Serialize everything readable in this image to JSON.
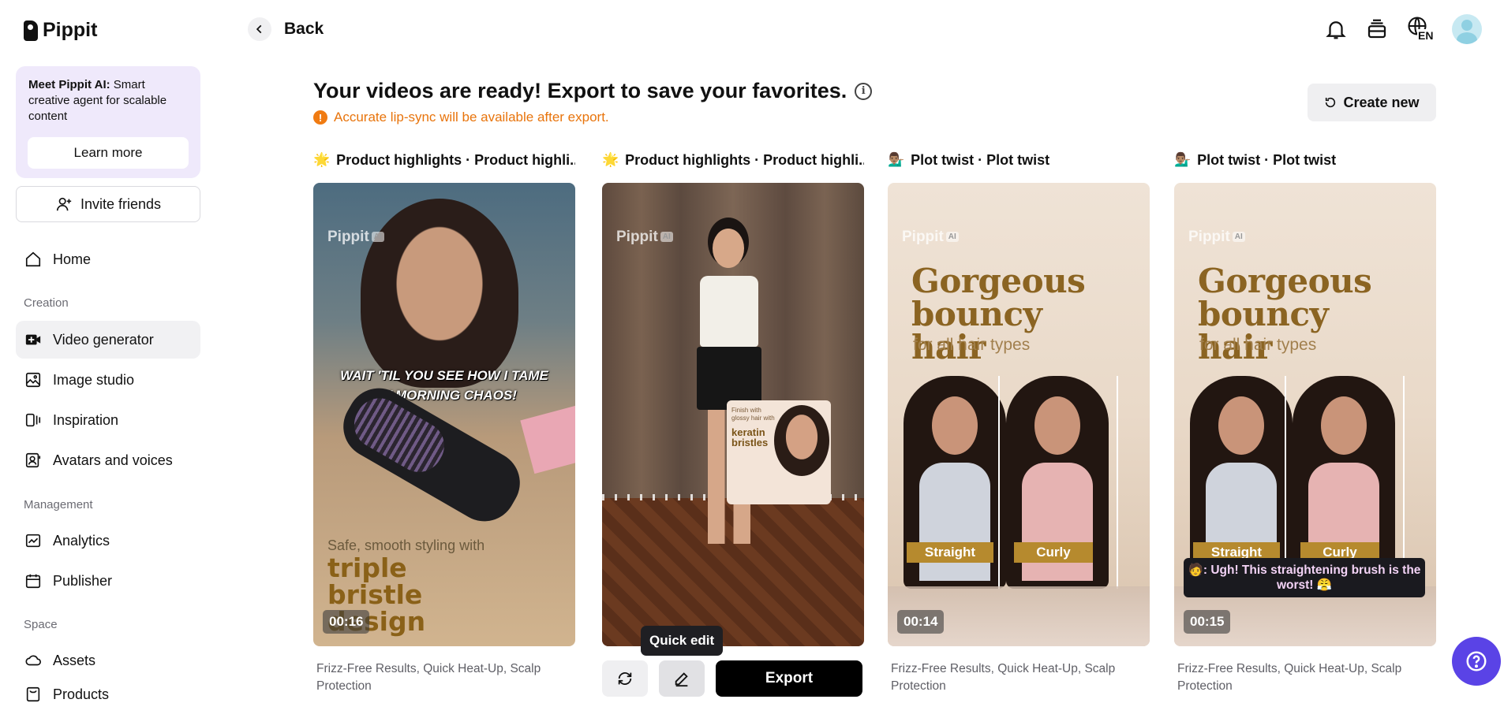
{
  "app": {
    "name": "Pippit"
  },
  "sidebar": {
    "promo_title": "Meet Pippit AI:",
    "promo_body": " Smart creative agent for scalable content",
    "learn_more": "Learn more",
    "invite": "Invite friends",
    "home": "Home",
    "sections": {
      "creation": "Creation",
      "management": "Management",
      "space": "Space"
    },
    "items": {
      "video_generator": "Video generator",
      "image_studio": "Image studio",
      "inspiration": "Inspiration",
      "avatars_voices": "Avatars and voices",
      "analytics": "Analytics",
      "publisher": "Publisher",
      "assets": "Assets",
      "products": "Products"
    },
    "active": "video_generator"
  },
  "topbar": {
    "back": "Back",
    "language": "EN"
  },
  "main": {
    "headline": "Your videos are ready! Export to save your favorites.",
    "info_glyph": "i",
    "warning_glyph": "!",
    "warning": "Accurate lip-sync will be available after export.",
    "create_new": "Create new"
  },
  "cards": [
    {
      "emoji": "🌟",
      "title": "Product highlights · Product highli...",
      "watermark": "Pippit",
      "watermark_badge": "AI",
      "caption": "WAIT 'TIL YOU SEE HOW I TAME MY MORNING CHAOS!",
      "overlay_small": "Safe, smooth styling with",
      "overlay_big": "triple bristle design",
      "duration": "00:16",
      "description": "Frizz-Free Results, Quick Heat-Up, Scalp Protection"
    },
    {
      "emoji": "🌟",
      "title": "Product highlights · Product highli...",
      "watermark": "Pippit",
      "watermark_badge": "AI",
      "inset_small": "Finish with glossy hair with",
      "inset_big": "keratin bristles"
    },
    {
      "emoji": "💁🏽‍♂️",
      "title": "Plot twist · Plot twist",
      "watermark": "Pippit",
      "watermark_badge": "AI",
      "headline": "Gorgeous bouncy hair",
      "subline": "for all hair types",
      "tag_left": "Straight",
      "tag_right": "Curly",
      "duration": "00:14",
      "description": "Frizz-Free Results, Quick Heat-Up, Scalp Protection"
    },
    {
      "emoji": "💁🏽‍♂️",
      "title": "Plot twist · Plot twist",
      "watermark": "Pippit",
      "watermark_badge": "AI",
      "headline": "Gorgeous bouncy hair",
      "subline": "for all hair types",
      "tag_left": "Straight",
      "tag_right": "Curly",
      "dialog": "🧑: Ugh! This straightening brush is the worst! 😤",
      "duration": "00:15",
      "description": "Frizz-Free Results, Quick Heat-Up, Scalp Protection"
    }
  ],
  "card_actions": {
    "tooltip": "Quick edit",
    "export": "Export"
  },
  "colors": {
    "accent_warning": "#e8740c",
    "help_button": "#5a43e6",
    "promo_bg": "#efe9fb",
    "export_bg": "#000000"
  },
  "icons": [
    "bell-icon",
    "stack-icon",
    "globe-language-icon",
    "avatar",
    "regenerate-icon",
    "pencil-icon",
    "help-icon"
  ]
}
